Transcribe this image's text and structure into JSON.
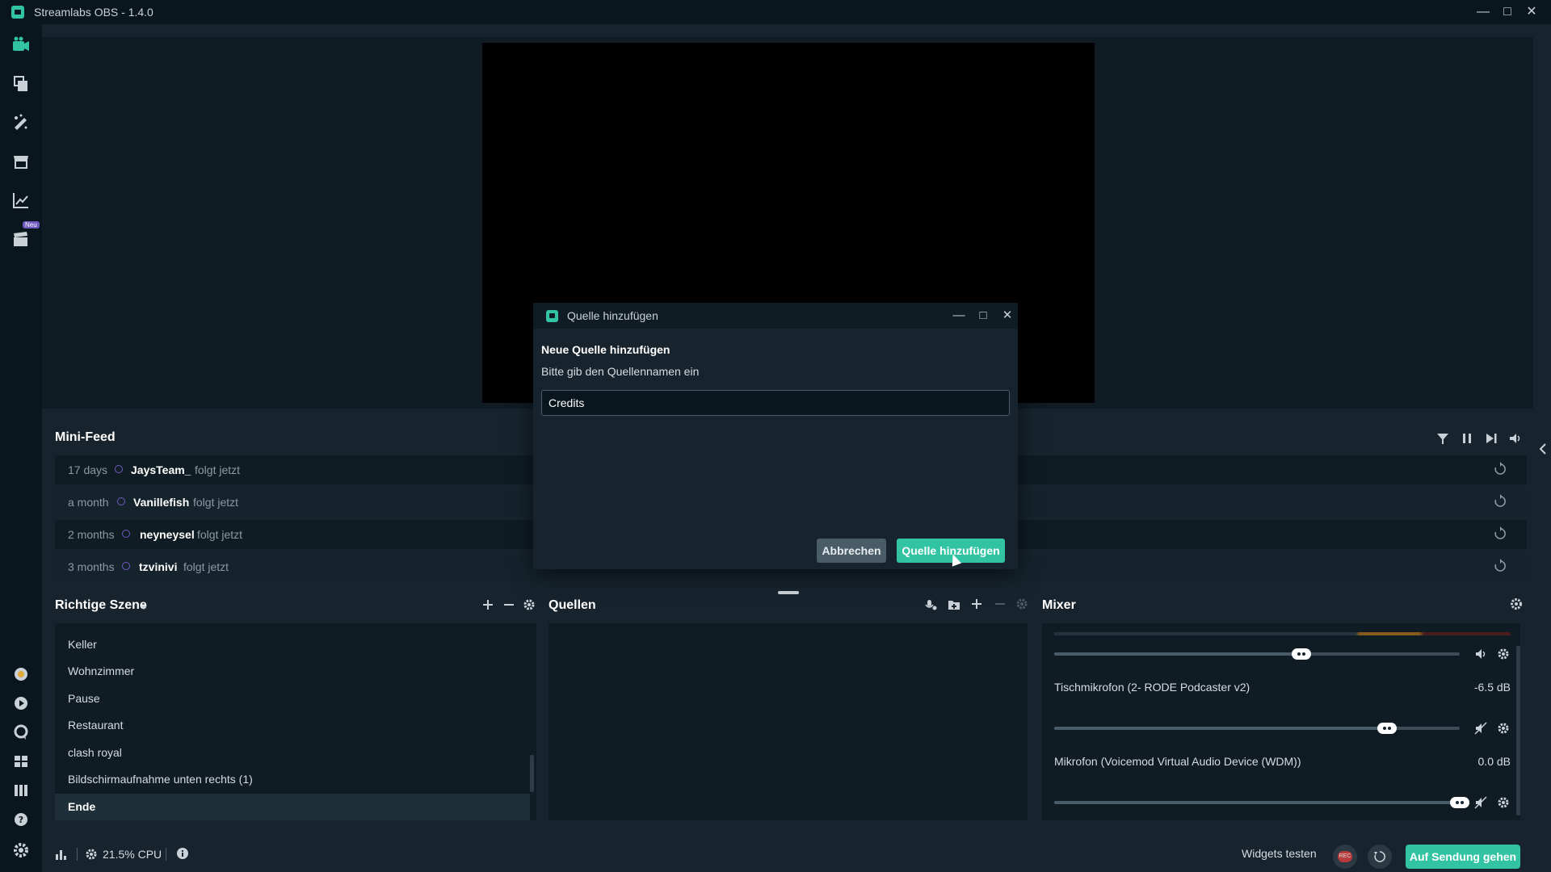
{
  "window": {
    "title": "Streamlabs OBS - 1.4.0",
    "controls": [
      "minimize",
      "maximize",
      "close"
    ]
  },
  "left_nav": {
    "top_icons": [
      "editor-icon",
      "themes-icon",
      "widgets-icon",
      "store-icon",
      "analytics-icon",
      "highlighter-icon"
    ],
    "new_badge": "Neu",
    "bottom_icons": [
      "prime-icon",
      "dashboard-icon",
      "chat-icon",
      "layouts-icon",
      "apps-icon",
      "help-icon",
      "settings-icon"
    ]
  },
  "minifeed": {
    "title": "Mini-Feed",
    "rows": [
      {
        "time": "17 days",
        "name": "JaysTeam_",
        "action": "folgt jetzt"
      },
      {
        "time": "a month",
        "name": "Vanillefish",
        "action": "folgt jetzt"
      },
      {
        "time": "2 months",
        "name": "neyneysel",
        "action": "folgt jetzt"
      },
      {
        "time": "3 months",
        "name": "tzvinivi",
        "action": "folgt jetzt"
      }
    ]
  },
  "scenes": {
    "title": "Richtige Szene",
    "items": [
      "Keller",
      "Wohnzimmer",
      "Pause",
      "Restaurant",
      "clash royal",
      "Bildschirmaufnahme unten rechts (1)",
      "Ende"
    ],
    "active_index": 6
  },
  "sources": {
    "title": "Quellen"
  },
  "mixer": {
    "title": "Mixer",
    "channels": [
      {
        "name": "",
        "db": "",
        "level": 0.61
      },
      {
        "name": "Tischmikrofon (2- RODE Podcaster v2)",
        "db": "-6.5 dB",
        "level": 0.82
      },
      {
        "name": "Mikrofon (Voicemod Virtual Audio Device (WDM))",
        "db": "0.0 dB",
        "level": 1.0
      }
    ]
  },
  "footer": {
    "cpu": "21.5% CPU",
    "widgets_test": "Widgets testen",
    "rec_label": "REC",
    "go_live": "Auf Sendung gehen"
  },
  "dialog": {
    "title": "Quelle hinzufügen",
    "heading": "Neue Quelle hinzufügen",
    "description": "Bitte gib den Quellennamen ein",
    "input_value": "Credits",
    "cancel": "Abbrechen",
    "confirm": "Quelle hinzufügen"
  },
  "colors": {
    "accent": "#31c3a2",
    "background": "#17242d",
    "panel": "#0f1c24",
    "nav": "#09161d"
  }
}
